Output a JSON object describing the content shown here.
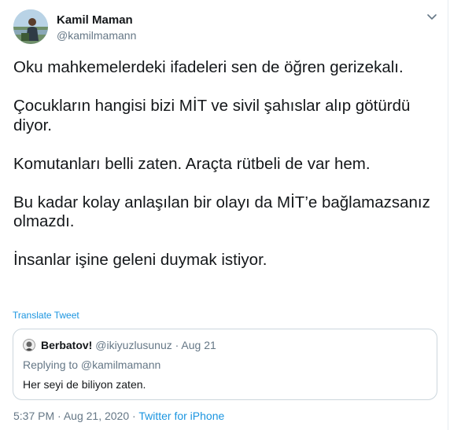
{
  "author": {
    "display_name": "Kamil Maman",
    "handle": "@kamilmamann",
    "avatar_icon": "profile-photo"
  },
  "menu_icon": "chevron-down-icon",
  "tweet": {
    "paragraphs": [
      "Oku mahkemelerdeki ifadeleri sen de öğren gerizekalı.",
      "Çocukların hangisi bizi MİT ve sivil şahıslar alıp götürdü diyor.",
      "Komutanları belli zaten. Araçta rütbeli de var hem.",
      "Bu kadar kolay anlaşılan bir olayı da MİT’e bağlamazsanız olmazdı.",
      "İnsanlar işine geleni duymak istiyor."
    ],
    "translate_label": "Translate Tweet"
  },
  "quoted_tweet": {
    "display_name": "Berbatov!",
    "handle": "@ikiyuzlusunuz",
    "separator": "·",
    "date": "Aug 21",
    "replying_to": "Replying to @kamilmamann",
    "text": "Her seyi de biliyon zaten."
  },
  "meta": {
    "time": "5:37 PM",
    "separator": "·",
    "date": "Aug 21, 2020",
    "source": "Twitter for iPhone"
  },
  "colors": {
    "link": "#1b95e0",
    "secondary_text": "#657786",
    "primary_text": "#14171a",
    "border": "#ccd6dd"
  }
}
